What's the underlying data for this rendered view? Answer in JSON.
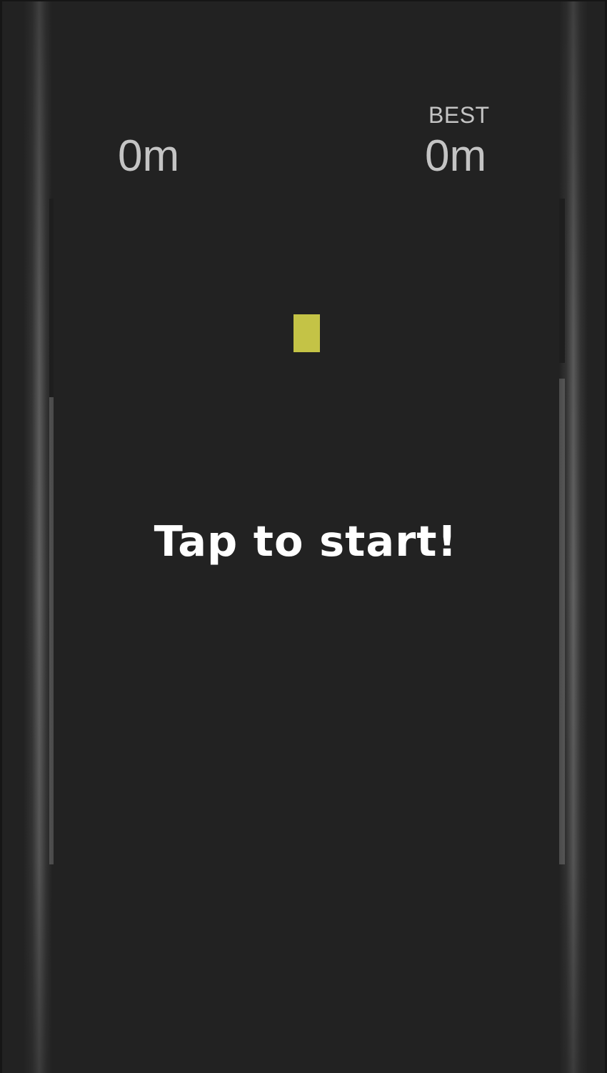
{
  "hud": {
    "current_distance": "0m",
    "best_label": "BEST",
    "best_distance": "0m"
  },
  "prompt": {
    "text": "Tap to start!"
  },
  "colors": {
    "background": "#222222",
    "player": "#c4c346",
    "score_text": "#c4c4c4",
    "prompt_text": "#ffffff"
  }
}
